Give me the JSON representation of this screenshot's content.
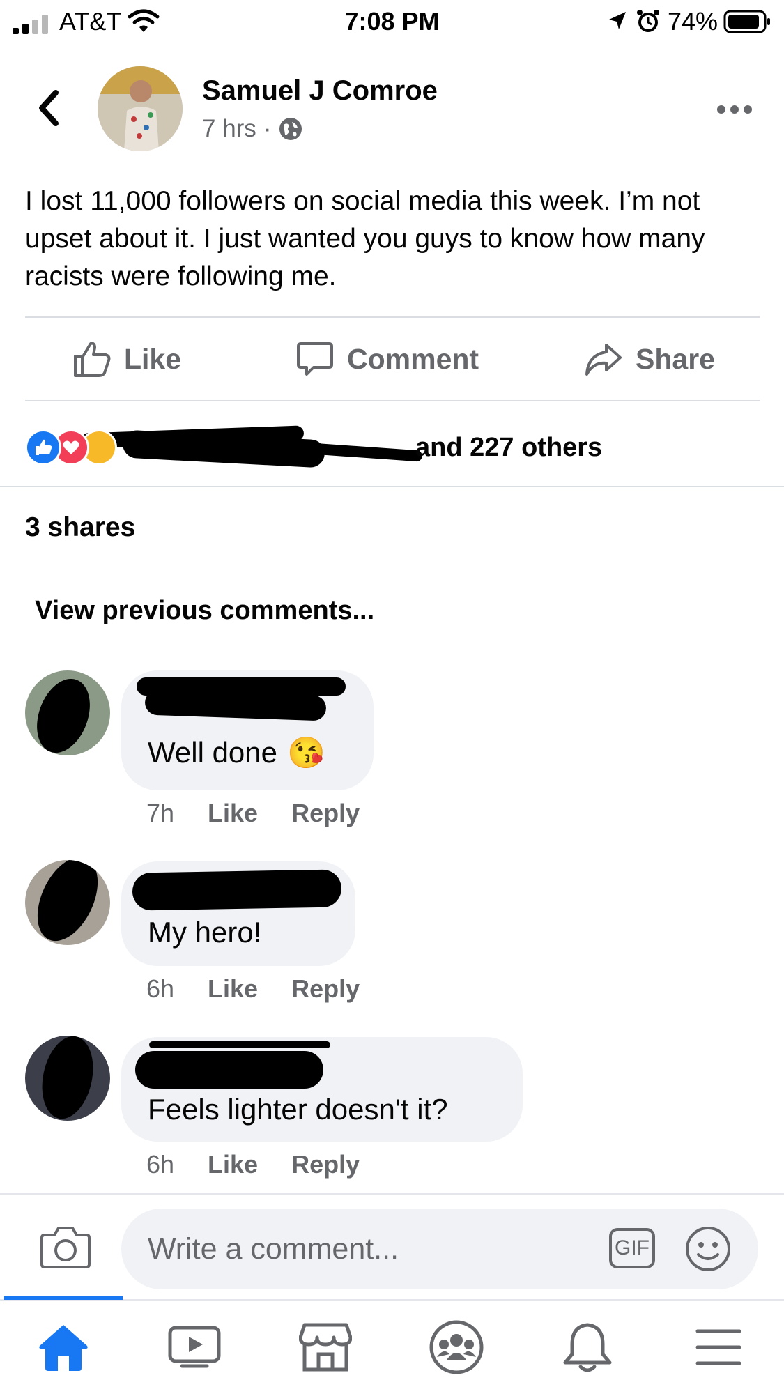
{
  "status_bar": {
    "carrier": "AT&T",
    "time": "7:08 PM",
    "battery": "74%"
  },
  "post": {
    "author": "Samuel J Comroe",
    "time": "7 hrs",
    "text": "I lost 11,000 followers on social media this week. I’m not upset about it. I just wanted you guys to know how many racists were following me."
  },
  "actions": {
    "like": "Like",
    "comment": "Comment",
    "share": "Share"
  },
  "reactions": {
    "summary": "and 227 others",
    "icons": [
      "like-reaction-icon",
      "love-reaction-icon",
      "haha-reaction-icon"
    ]
  },
  "shares": "3 shares",
  "view_previous": "View previous comments...",
  "comments": [
    {
      "text": "Well done",
      "emoji": "😘",
      "time": "7h",
      "like": "Like",
      "reply": "Reply"
    },
    {
      "text": "My hero!",
      "time": "6h",
      "like": "Like",
      "reply": "Reply"
    },
    {
      "text": "Feels lighter doesn't it?",
      "time": "6h",
      "like": "Like",
      "reply": "Reply"
    }
  ],
  "composer": {
    "placeholder": "Write a comment...",
    "gif": "GIF"
  },
  "tabs": [
    "home-icon",
    "watch-icon",
    "marketplace-icon",
    "groups-icon",
    "notifications-icon",
    "menu-icon"
  ],
  "colors": {
    "accent": "#1877f2",
    "secondary_text": "#65676b",
    "bubble": "#f0f2f5"
  }
}
